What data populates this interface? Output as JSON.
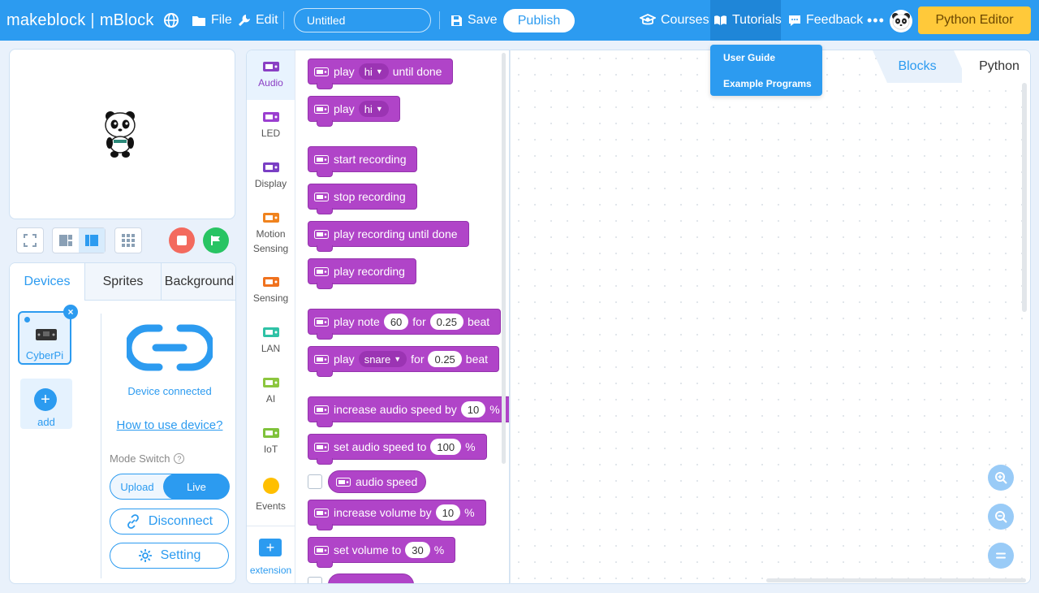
{
  "topbar": {
    "brand_left": "makeblock",
    "brand_sep": "|",
    "brand_right": "mBlock",
    "file": "File",
    "edit": "Edit",
    "project_title": "Untitled",
    "save": "Save",
    "publish": "Publish",
    "courses": "Courses",
    "tutorials": "Tutorials",
    "feedback": "Feedback",
    "more": "•••",
    "python_editor": "Python Editor"
  },
  "tutorials_menu": [
    "User Guide",
    "Example Programs"
  ],
  "devices_panel": {
    "tabs": [
      "Devices",
      "Sprites",
      "Background"
    ],
    "device_name": "CyberPi",
    "close": "×",
    "add_label": "add",
    "add_plus": "+",
    "status": "Device connected",
    "howto": "How to use device?",
    "mode_label": "Mode Switch",
    "mode_help": "?",
    "mode_upload": "Upload",
    "mode_live": "Live",
    "disconnect": "Disconnect",
    "setting": "Setting"
  },
  "categories": {
    "audio": "Audio",
    "led": "LED",
    "display": "Display",
    "motion": "Motion Sensing",
    "sensing": "Sensing",
    "lan": "LAN",
    "ai": "AI",
    "iot": "IoT",
    "events": "Events",
    "extension": "extension",
    "extension_plus": "+"
  },
  "blocks": {
    "b1": {
      "t1": "play",
      "dd": "hi",
      "t2": "until done"
    },
    "b2": {
      "t1": "play",
      "dd": "hi"
    },
    "b3": {
      "t1": "start recording"
    },
    "b4": {
      "t1": "stop recording"
    },
    "b5": {
      "t1": "play recording until done"
    },
    "b6": {
      "t1": "play recording"
    },
    "b7": {
      "t1": "play note",
      "v1": "60",
      "t2": "for",
      "v2": "0.25",
      "t3": "beat"
    },
    "b8": {
      "t1": "play",
      "dd": "snare",
      "t2": "for",
      "v2": "0.25",
      "t3": "beat"
    },
    "b9": {
      "t1": "increase audio speed by",
      "v1": "10",
      "t2": "%"
    },
    "b10": {
      "t1": "set audio speed to",
      "v1": "100",
      "t2": "%"
    },
    "r1": {
      "t1": "audio speed"
    },
    "b11": {
      "t1": "increase volume by",
      "v1": "10",
      "t2": "%"
    },
    "b12": {
      "t1": "set volume to",
      "v1": "30",
      "t2": "%"
    }
  },
  "workspace": {
    "tab_blocks": "Blocks",
    "tab_python": "Python"
  },
  "colors": {
    "topbar": "#2c9bf0",
    "audio_block": "#b044c8",
    "python_editor": "#ffc93a",
    "stop": "#f36a5e",
    "go": "#28c463"
  }
}
